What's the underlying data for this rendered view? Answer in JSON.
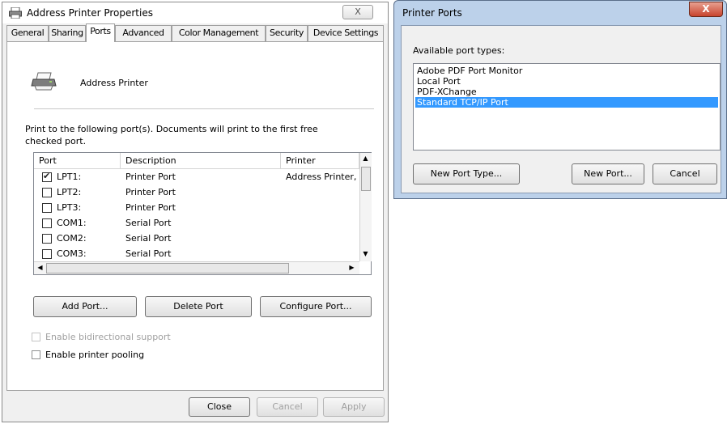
{
  "properties_dialog": {
    "title": "Address Printer Properties",
    "close_label": "X",
    "tabs": [
      {
        "label": "General"
      },
      {
        "label": "Sharing"
      },
      {
        "label": "Ports"
      },
      {
        "label": "Advanced"
      },
      {
        "label": "Color Management"
      },
      {
        "label": "Security"
      },
      {
        "label": "Device Settings"
      }
    ],
    "active_tab": "Ports",
    "printer_name": "Address Printer",
    "instruction": "Print to the following port(s). Documents will print to the first free checked port.",
    "port_table": {
      "columns": [
        "Port",
        "Description",
        "Printer"
      ],
      "rows": [
        {
          "port": "LPT1:",
          "description": "Printer Port",
          "printer": "Address Printer,",
          "checked": true
        },
        {
          "port": "LPT2:",
          "description": "Printer Port",
          "printer": "",
          "checked": false
        },
        {
          "port": "LPT3:",
          "description": "Printer Port",
          "printer": "",
          "checked": false
        },
        {
          "port": "COM1:",
          "description": "Serial Port",
          "printer": "",
          "checked": false
        },
        {
          "port": "COM2:",
          "description": "Serial Port",
          "printer": "",
          "checked": false
        },
        {
          "port": "COM3:",
          "description": "Serial Port",
          "printer": "",
          "checked": false
        }
      ]
    },
    "buttons": {
      "add_port": "Add Port...",
      "delete_port": "Delete Port",
      "configure_port": "Configure Port..."
    },
    "options": {
      "bidirectional": {
        "label": "Enable bidirectional support",
        "checked": false,
        "enabled": false
      },
      "pooling": {
        "label": "Enable printer pooling",
        "checked": false,
        "enabled": true
      }
    },
    "footer": {
      "close": "Close",
      "cancel": "Cancel",
      "apply": "Apply"
    }
  },
  "ports_dialog": {
    "title": "Printer Ports",
    "close_label": "X",
    "available_label": "Available port types:",
    "port_types": [
      {
        "label": "Adobe PDF Port Monitor",
        "selected": false
      },
      {
        "label": "Local Port",
        "selected": false
      },
      {
        "label": "PDF-XChange",
        "selected": false
      },
      {
        "label": "Standard TCP/IP Port",
        "selected": true
      }
    ],
    "buttons": {
      "new_port_type": "New Port Type...",
      "new_port": "New Port...",
      "cancel": "Cancel"
    }
  },
  "colors": {
    "selection": "#3399ff",
    "aero_frame": "#bcd1ea",
    "close_red": "#c7442e"
  }
}
